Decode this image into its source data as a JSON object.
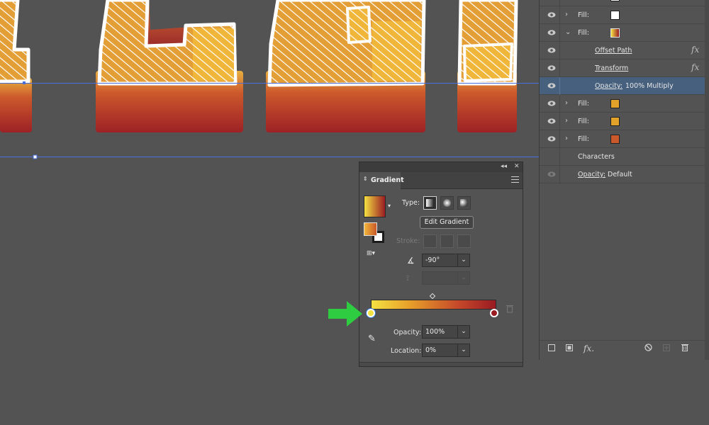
{
  "appearance_panel": {
    "rows": [
      {
        "label": "Fill:",
        "swatch": "#ffffff",
        "chevron": "›"
      },
      {
        "label": "Fill:",
        "swatch": "gradient",
        "chevron": "⌄"
      },
      {
        "label": "Offset Path",
        "fx": "fx"
      },
      {
        "label": "Transform",
        "fx": "fx"
      },
      {
        "label_link": "Opacity:",
        "value": "100% Multiply"
      },
      {
        "label": "Fill:",
        "swatch": "#e3a22a",
        "chevron": "›"
      },
      {
        "label": "Fill:",
        "swatch": "#e3a22a",
        "chevron": "›"
      },
      {
        "label": "Fill:",
        "swatch": "#c9582a",
        "chevron": "›"
      },
      {
        "label": "Characters"
      },
      {
        "label_link": "Opacity:",
        "value": "Default"
      }
    ]
  },
  "gradient_panel": {
    "tab_title": "Gradient",
    "type_label": "Type:",
    "edit_gradient_label": "Edit Gradient",
    "stroke_label": "Stroke:",
    "angle_value": "-90°",
    "opacity_label": "Opacity:",
    "opacity_value": "100%",
    "location_label": "Location:",
    "location_value": "0%",
    "stops": [
      {
        "color": "#f4e142",
        "location": 0
      },
      {
        "color": "#9a1b22",
        "location": 100
      }
    ]
  },
  "colors": {
    "highlight_arrow": "#2ecc40",
    "selected_row": "#46607e"
  }
}
